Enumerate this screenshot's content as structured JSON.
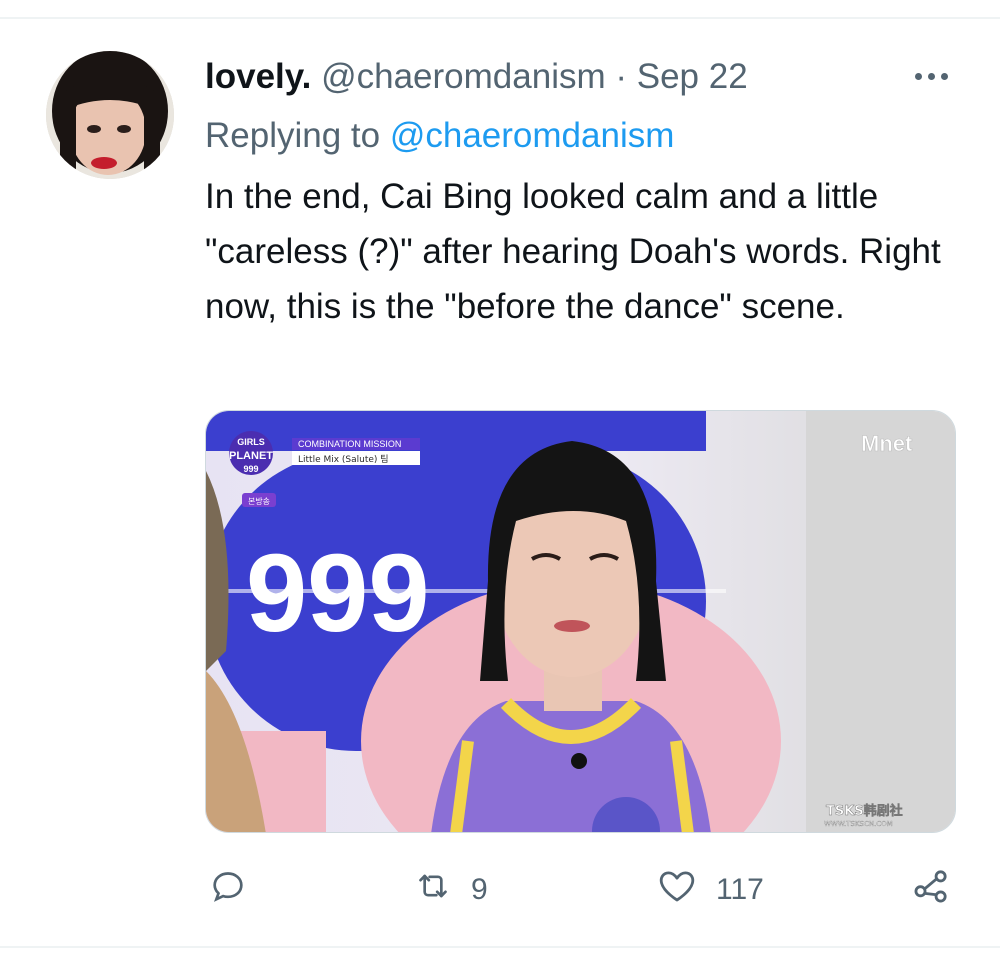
{
  "tweet": {
    "author_name": "lovely.",
    "author_handle": "@chaeromdanism",
    "separator": "·",
    "date": "Sep 22",
    "replying_prefix": "Replying to",
    "replying_handle": "@chaeromdanism",
    "text": "In the end, Cai Bing looked calm and a little \"careless (?)\" after hearing Doah's words. Right now, this is the \"before the dance\" scene."
  },
  "media": {
    "show_logo_line1": "GIRLS",
    "show_logo_line2": "PLANET",
    "show_logo_line3": "999",
    "broadcast_badge": "본방송",
    "mission_title": "COMBINATION MISSION",
    "mission_song": "Little Mix (Salute) 팀",
    "backdrop_text": "999",
    "channel_logo": "Mnet",
    "watermark_line1": "TSKS韩剧社",
    "watermark_line2": "WWW.TSKSCN.COM"
  },
  "actions": {
    "reply_icon": "reply-bubble-icon",
    "retweet_icon": "retweet-icon",
    "retweet_count": "9",
    "like_icon": "heart-icon",
    "like_count": "117",
    "share_icon": "share-icon"
  },
  "colors": {
    "link": "#1d9bf0",
    "muted": "#536471",
    "text": "#0f1419",
    "jersey": "#8b6fd6",
    "jersey_trim": "#f3d54a",
    "backdrop_blue": "#3b3fcf"
  }
}
